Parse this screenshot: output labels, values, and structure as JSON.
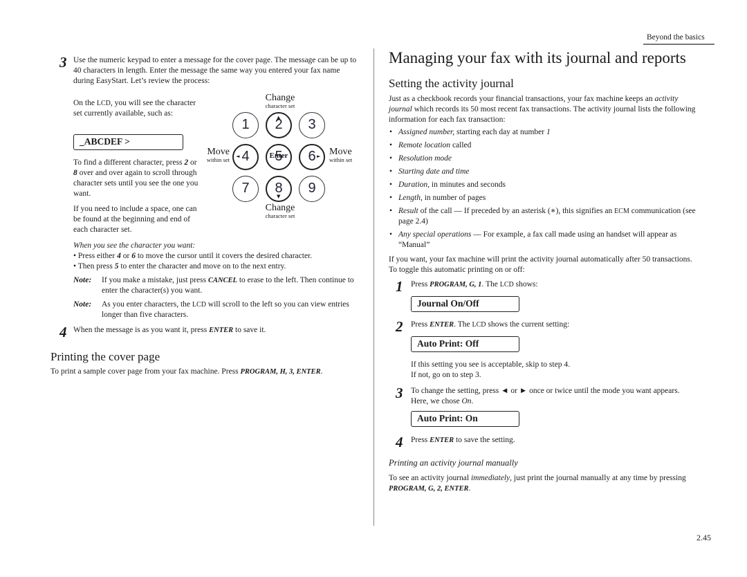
{
  "header": {
    "section": "Beyond the basics",
    "page_number": "2.45"
  },
  "left": {
    "step3": {
      "num": "3",
      "text": "Use the numeric keypad to enter a message for the cover page. The message can be up to 40 characters in length. Enter the message the same way you entered your fax name during EasyStart. Let’s review the process:"
    },
    "lcd_intro": {
      "pre": "On the ",
      "lcd": "LCD",
      "post": ", you will see the character set currently available, such as:"
    },
    "lcd_display": "_ABCDEF  >",
    "find_char": {
      "p1": "To find a different character, press ",
      "k1": "2",
      "p2": " or ",
      "k2": "8",
      "p3": " over and over again to scroll through character sets until you see the one you want."
    },
    "space_note": "If you need to include a space, one can be found at the beginning and end of each character set.",
    "keypad": {
      "keys": [
        "1",
        "2",
        "3",
        "4",
        "5",
        "6",
        "7",
        "8",
        "9"
      ],
      "enter_label": "Enter",
      "top_label": {
        "big": "Change",
        "small": "character set"
      },
      "bottom_label": {
        "big": "Change",
        "small": "character set"
      },
      "left_label": {
        "big": "Move",
        "small": "within set"
      },
      "right_label": {
        "big": "Move",
        "small": "within set"
      }
    },
    "when_see": "When you see the character you want:",
    "bullets": [
      {
        "p1": "Press either ",
        "k1": "4",
        "p2": " or ",
        "k2": "6",
        "p3": " to move the cursor until it covers the desired character."
      },
      {
        "p1": "Then press ",
        "k1": "5",
        "p2": " to enter the character and move on to the next entry."
      }
    ],
    "notes": [
      {
        "label": "Note:",
        "p1": "If you make a mistake, just press ",
        "key": "CANCEL",
        "p2": " to erase to the left. Then continue to enter the character(s) you want."
      },
      {
        "label": "Note:",
        "p1": "As you enter characters, the ",
        "key": "LCD",
        "p2": " will scroll to the left so you can view entries longer than five characters."
      }
    ],
    "step4": {
      "num": "4",
      "p1": "When the message is as you want it, press ",
      "key": "ENTER",
      "p2": " to save it."
    },
    "cover_heading": "Printing the cover page",
    "cover_text": {
      "p1": "To print a sample cover page from your fax machine. Press ",
      "keys": "PROGRAM, H, 3, ENTER",
      "p2": "."
    }
  },
  "right": {
    "title": "Managing your fax with its journal and reports",
    "subtitle": "Setting the activity journal",
    "intro": {
      "p1": "Just as a checkbook records your financial transactions, your fax machine keeps an ",
      "em": "activity journal",
      "p2": " which records its 50 most recent fax transactions. The activity journal lists the following information for each fax transaction:"
    },
    "bullets": [
      {
        "em": "Assigned number,",
        "rest": " starting each day at number ",
        "em2": "1"
      },
      {
        "em": "Remote location",
        "rest": " called",
        "em2": ""
      },
      {
        "em": "Resolution mode",
        "rest": "",
        "em2": ""
      },
      {
        "em": "Starting date and time",
        "rest": "",
        "em2": ""
      },
      {
        "em": "Duration",
        "rest": ", in minutes and seconds",
        "em2": ""
      },
      {
        "em": "Length,",
        "rest": " in number of pages",
        "em2": ""
      }
    ],
    "bullet_result": {
      "em": "Result",
      "p1": " of the call — If preceded by an asterisk (∗), this signifies an ",
      "sc": "ECM",
      "p2": " communication (see page 2.4)"
    },
    "bullet_special": {
      "em": "Any special operations",
      "p1": " — For example, a fax call made using an handset will appear as “Manual”"
    },
    "auto_text": "If you want, your fax machine will print the activity journal automatically after 50 transactions. To toggle this automatic printing on or off:",
    "steps": [
      {
        "num": "1",
        "p1": "Press ",
        "key": "PROGRAM, G, 1",
        "p2": ". The ",
        "sc": "LCD",
        "p3": " shows:",
        "lcd": "Journal On/Off"
      },
      {
        "num": "2",
        "p1": "Press ",
        "key": "ENTER",
        "p2": ". The ",
        "sc": "LCD",
        "p3": " shows the current setting:",
        "lcd": "Auto Print:  Off"
      },
      {
        "num": "3",
        "p1": "To change the setting, press ◄ or ► once or twice until the mode you want appears. Here, we chose ",
        "em": "On",
        "p2": ".",
        "lcd": "Auto Print:  On"
      },
      {
        "num": "4",
        "p1": "Press ",
        "key": "ENTER",
        "p2": " to save the setting."
      }
    ],
    "acceptable": "If this setting you see is acceptable, skip to step 4.",
    "if_not": "If not, go on to step 3.",
    "manual_heading": "Printing an activity journal manually",
    "manual_text": {
      "p1": "To see an activity journal ",
      "em": "immediately",
      "p2": ", just print the journal manually at any time by pressing ",
      "keys": "PROGRAM, G, 2, ENTER",
      "p3": "."
    }
  }
}
